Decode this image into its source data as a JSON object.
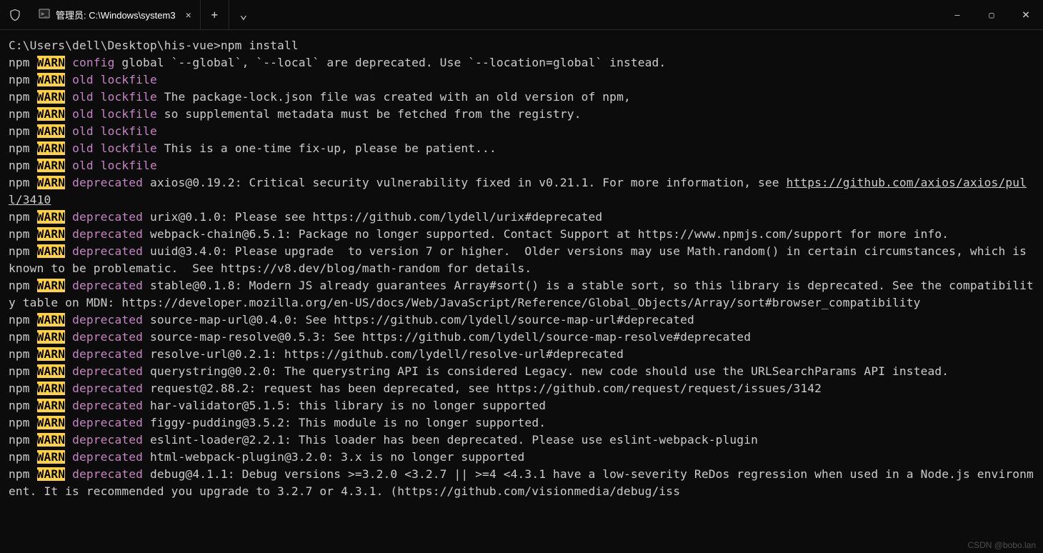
{
  "titlebar": {
    "shield_icon": "shield",
    "tab": {
      "icon": "cmd",
      "title": "管理员:  C:\\Windows\\system3",
      "close": "×"
    },
    "new_tab": "+",
    "dropdown": "⌄",
    "minimize": "—",
    "maximize": "▢",
    "close": "×"
  },
  "prompt": {
    "path": "C:\\Users\\dell\\Desktop\\his-vue>",
    "cmd": "npm install"
  },
  "lines": [
    {
      "prefix": "npm",
      "tag": "WARN",
      "kw": "config",
      "msg": " global `--global`, `--local` are deprecated. Use `--location=global` instead."
    },
    {
      "prefix": "npm",
      "tag": "WARN",
      "kw": "old lockfile",
      "msg": ""
    },
    {
      "prefix": "npm",
      "tag": "WARN",
      "kw": "old lockfile",
      "msg": " The package-lock.json file was created with an old version of npm,"
    },
    {
      "prefix": "npm",
      "tag": "WARN",
      "kw": "old lockfile",
      "msg": " so supplemental metadata must be fetched from the registry."
    },
    {
      "prefix": "npm",
      "tag": "WARN",
      "kw": "old lockfile",
      "msg": ""
    },
    {
      "prefix": "npm",
      "tag": "WARN",
      "kw": "old lockfile",
      "msg": " This is a one-time fix-up, please be patient..."
    },
    {
      "prefix": "npm",
      "tag": "WARN",
      "kw": "old lockfile",
      "msg": ""
    },
    {
      "prefix": "npm",
      "tag": "WARN",
      "kw": "deprecated",
      "msg": " axios@0.19.2: Critical security vulnerability fixed in v0.21.1. For more information, see ",
      "link": "https://github.com/axios/axios/pull/3410"
    },
    {
      "prefix": "npm",
      "tag": "WARN",
      "kw": "deprecated",
      "msg": " urix@0.1.0: Please see https://github.com/lydell/urix#deprecated"
    },
    {
      "prefix": "npm",
      "tag": "WARN",
      "kw": "deprecated",
      "msg": " webpack-chain@6.5.1: Package no longer supported. Contact Support at https://www.npmjs.com/support for more info."
    },
    {
      "prefix": "npm",
      "tag": "WARN",
      "kw": "deprecated",
      "msg": " uuid@3.4.0: Please upgrade  to version 7 or higher.  Older versions may use Math.random() in certain circumstances, which is known to be problematic.  See https://v8.dev/blog/math-random for details."
    },
    {
      "prefix": "npm",
      "tag": "WARN",
      "kw": "deprecated",
      "msg": " stable@0.1.8: Modern JS already guarantees Array#sort() is a stable sort, so this library is deprecated. See the compatibility table on MDN: https://developer.mozilla.org/en-US/docs/Web/JavaScript/Reference/Global_Objects/Array/sort#browser_compatibility"
    },
    {
      "prefix": "npm",
      "tag": "WARN",
      "kw": "deprecated",
      "msg": " source-map-url@0.4.0: See https://github.com/lydell/source-map-url#deprecated"
    },
    {
      "prefix": "npm",
      "tag": "WARN",
      "kw": "deprecated",
      "msg": " source-map-resolve@0.5.3: See https://github.com/lydell/source-map-resolve#deprecated"
    },
    {
      "prefix": "npm",
      "tag": "WARN",
      "kw": "deprecated",
      "msg": " resolve-url@0.2.1: https://github.com/lydell/resolve-url#deprecated"
    },
    {
      "prefix": "npm",
      "tag": "WARN",
      "kw": "deprecated",
      "msg": " querystring@0.2.0: The querystring API is considered Legacy. new code should use the URLSearchParams API instead."
    },
    {
      "prefix": "npm",
      "tag": "WARN",
      "kw": "deprecated",
      "msg": " request@2.88.2: request has been deprecated, see https://github.com/request/request/issues/3142"
    },
    {
      "prefix": "npm",
      "tag": "WARN",
      "kw": "deprecated",
      "msg": " har-validator@5.1.5: this library is no longer supported"
    },
    {
      "prefix": "npm",
      "tag": "WARN",
      "kw": "deprecated",
      "msg": " figgy-pudding@3.5.2: This module is no longer supported."
    },
    {
      "prefix": "npm",
      "tag": "WARN",
      "kw": "deprecated",
      "msg": " eslint-loader@2.2.1: This loader has been deprecated. Please use eslint-webpack-plugin"
    },
    {
      "prefix": "npm",
      "tag": "WARN",
      "kw": "deprecated",
      "msg": " html-webpack-plugin@3.2.0: 3.x is no longer supported"
    },
    {
      "prefix": "npm",
      "tag": "WARN",
      "kw": "deprecated",
      "msg": " debug@4.1.1: Debug versions >=3.2.0 <3.2.7 || >=4 <4.3.1 have a low-severity ReDos regression when used in a Node.js environment. It is recommended you upgrade to 3.2.7 or 4.3.1. (https://github.com/visionmedia/debug/iss"
    }
  ],
  "watermark": "CSDN @bobo.lan"
}
